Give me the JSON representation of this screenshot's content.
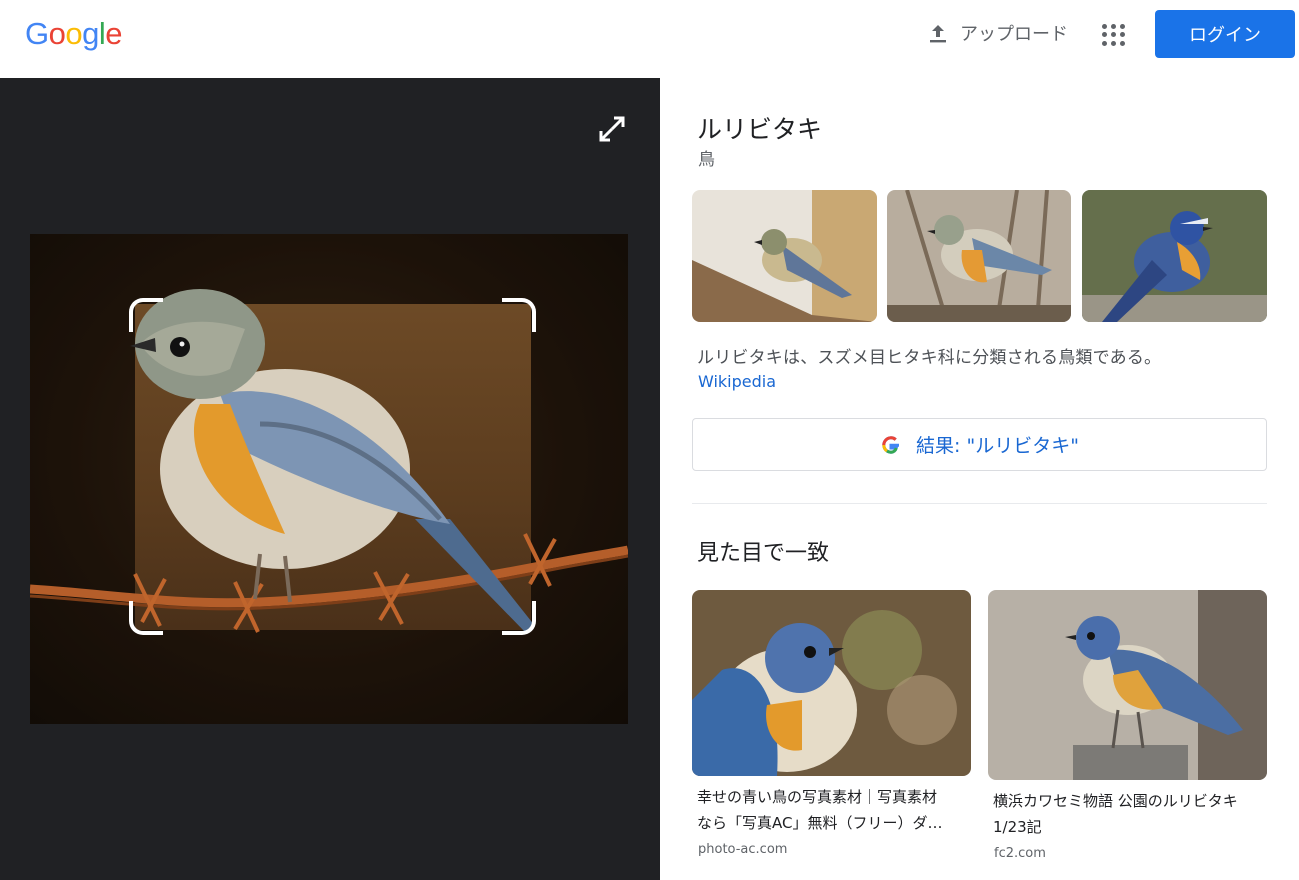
{
  "header": {
    "logo": "Google",
    "upload_label": "アップロード",
    "login_label": "ログイン"
  },
  "entity": {
    "title": "ルリビタキ",
    "subtitle": "鳥",
    "description": "ルリビタキは、スズメ目ヒタキ科に分類される鳥類である。",
    "source_link": "Wikipedia",
    "search_button": "結果: \"ルリビタキ\""
  },
  "visual_matches": {
    "title": "見た目で一致",
    "items": [
      {
        "title_line1": "幸せの青い鳥の写真素材｜写真素材",
        "title_line2": "なら「写真AC」無料（フリー）ダ…",
        "source": "photo-ac.com"
      },
      {
        "title_line1": "横浜カワセミ物語 公園のルリビタキ",
        "title_line2": "1/23記",
        "source": "fc2.com"
      }
    ]
  },
  "colors": {
    "accent": "#1a73e8",
    "link": "#1967d2",
    "viewer_bg": "#202124"
  },
  "icons": [
    "upload-icon",
    "apps-grid-icon",
    "expand-icon",
    "google-g-icon"
  ]
}
